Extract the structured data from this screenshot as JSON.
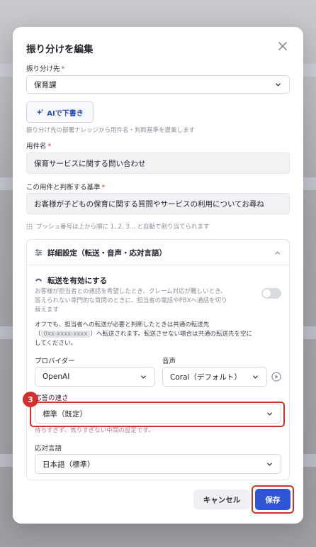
{
  "dialog": {
    "title": "振り分けを編集"
  },
  "destination": {
    "label": "振り分け先",
    "required_mark": "*",
    "value": "保育課"
  },
  "ai_write": {
    "label": "AIで下書き",
    "hint": "振り分け先の部署ナレッジから用件名・判断基準を提案します"
  },
  "subject": {
    "label": "用件名",
    "required_mark": "*",
    "value": "保育サービスに関する問い合わせ"
  },
  "criteria": {
    "label": "この用件と判断する基準",
    "required_mark": "*",
    "value": "お客様が子どもの保育に関する質問やサービスの利用についてお尋ね"
  },
  "push_hint": "プッシュ番号は上から順に 1, 2, 3... と自動で割り当てられます",
  "advanced": {
    "title": "詳細設定（転送・音声・応対言語）",
    "transfer": {
      "title": "転送を有効にする",
      "desc_line1": "お客様が担当者との通話を希望したとき、クレーム対応が難しいとき、",
      "desc_line2": "答えられない専門的な質問のときに、担当者の電話やPBXへ通話を切り",
      "desc_line3": "替えます",
      "off_line1": "オフでも、担当者への転送が必要と判断したときは共通の転送先",
      "off_prefix": "（",
      "off_masked": "0xx-xxxx-xxxx",
      "off_suffix": "）へ転送されます。転送させない場合は共通の転送先を空に",
      "off_line3": "してください。"
    },
    "provider": {
      "label": "プロバイダー",
      "value": "OpenAI"
    },
    "voice": {
      "label": "音声",
      "value": "Coral（デフォルト）"
    },
    "speed": {
      "label": "応答の速さ",
      "value": "標準（既定）",
      "hint": "待ちすぎず、焦りすぎない中間の設定です。"
    },
    "language": {
      "label": "応対言語",
      "value": "日本語（標準）"
    }
  },
  "annotation": {
    "step": "3"
  },
  "footer": {
    "cancel": "キャンセル",
    "save": "保存"
  },
  "colors": {
    "accent": "#2f55d4",
    "highlight": "#d32f2f",
    "required": "#d33a3a"
  }
}
